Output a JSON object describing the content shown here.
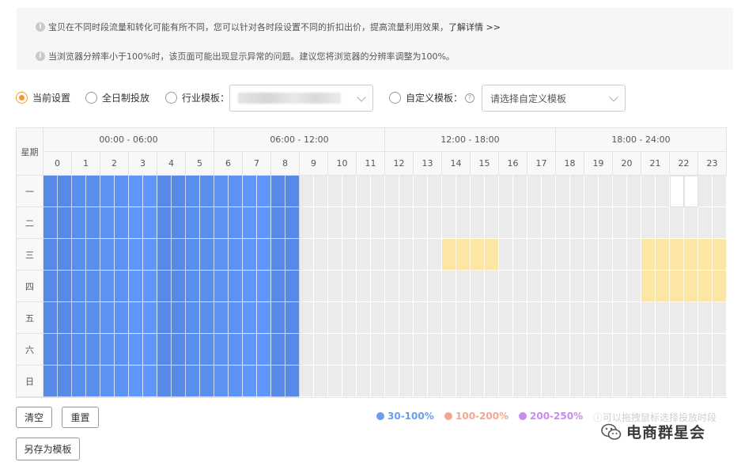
{
  "notice": {
    "line1": "宝贝在不同时段流量和转化可能有所不同，您可以针对各时段设置不同的折扣出价，提高流量利用效果，",
    "line1_link": "了解详情 >>",
    "line2": "当浏览器分辨率小于100%时，该页面可能出现显示异常的问题。建议您将浏览器的分辨率调整为100%。",
    "icon": "info-icon"
  },
  "options": {
    "current": "当前设置",
    "allday": "全日制投放",
    "industry": "行业模板：",
    "custom": "自定义模板：",
    "custom_placeholder": "请选择自定义模板",
    "selected": "current"
  },
  "grid": {
    "corner": "星期",
    "ranges": [
      "00:00 - 06:00",
      "06:00 - 12:00",
      "12:00 - 18:00",
      "18:00 - 24:00"
    ],
    "hours": [
      "0",
      "1",
      "2",
      "3",
      "4",
      "5",
      "6",
      "7",
      "8",
      "9",
      "10",
      "11",
      "12",
      "13",
      "14",
      "15",
      "16",
      "17",
      "18",
      "19",
      "20",
      "21",
      "22",
      "23"
    ],
    "days": [
      "一",
      "二",
      "三",
      "四",
      "五",
      "六",
      "日"
    ],
    "blue_hours": 9,
    "yellow": [
      {
        "day": 2,
        "hours": [
          14,
          15
        ]
      },
      {
        "day": 2,
        "hours": [
          21,
          22,
          23
        ]
      },
      {
        "day": 3,
        "hours": [
          21,
          22,
          23
        ]
      }
    ],
    "white": [
      {
        "day": 0,
        "hours": [
          22
        ]
      }
    ],
    "colors": {
      "blue": "#5b8ff0",
      "gray": "#ebebeb",
      "yellow": "#fbe6a4",
      "white": "#ffffff"
    }
  },
  "buttons": {
    "clear": "清空",
    "reset": "重置",
    "save_template": "另存为模板"
  },
  "legend": [
    {
      "label": "30-100%",
      "color": "#6a9cf0"
    },
    {
      "label": "100-200%",
      "color": "#f4a58e"
    },
    {
      "label": "200-250%",
      "color": "#c68bf0"
    }
  ],
  "hint": "可以拖拽鼠标选择投放时段",
  "watermark": "电商群星会"
}
